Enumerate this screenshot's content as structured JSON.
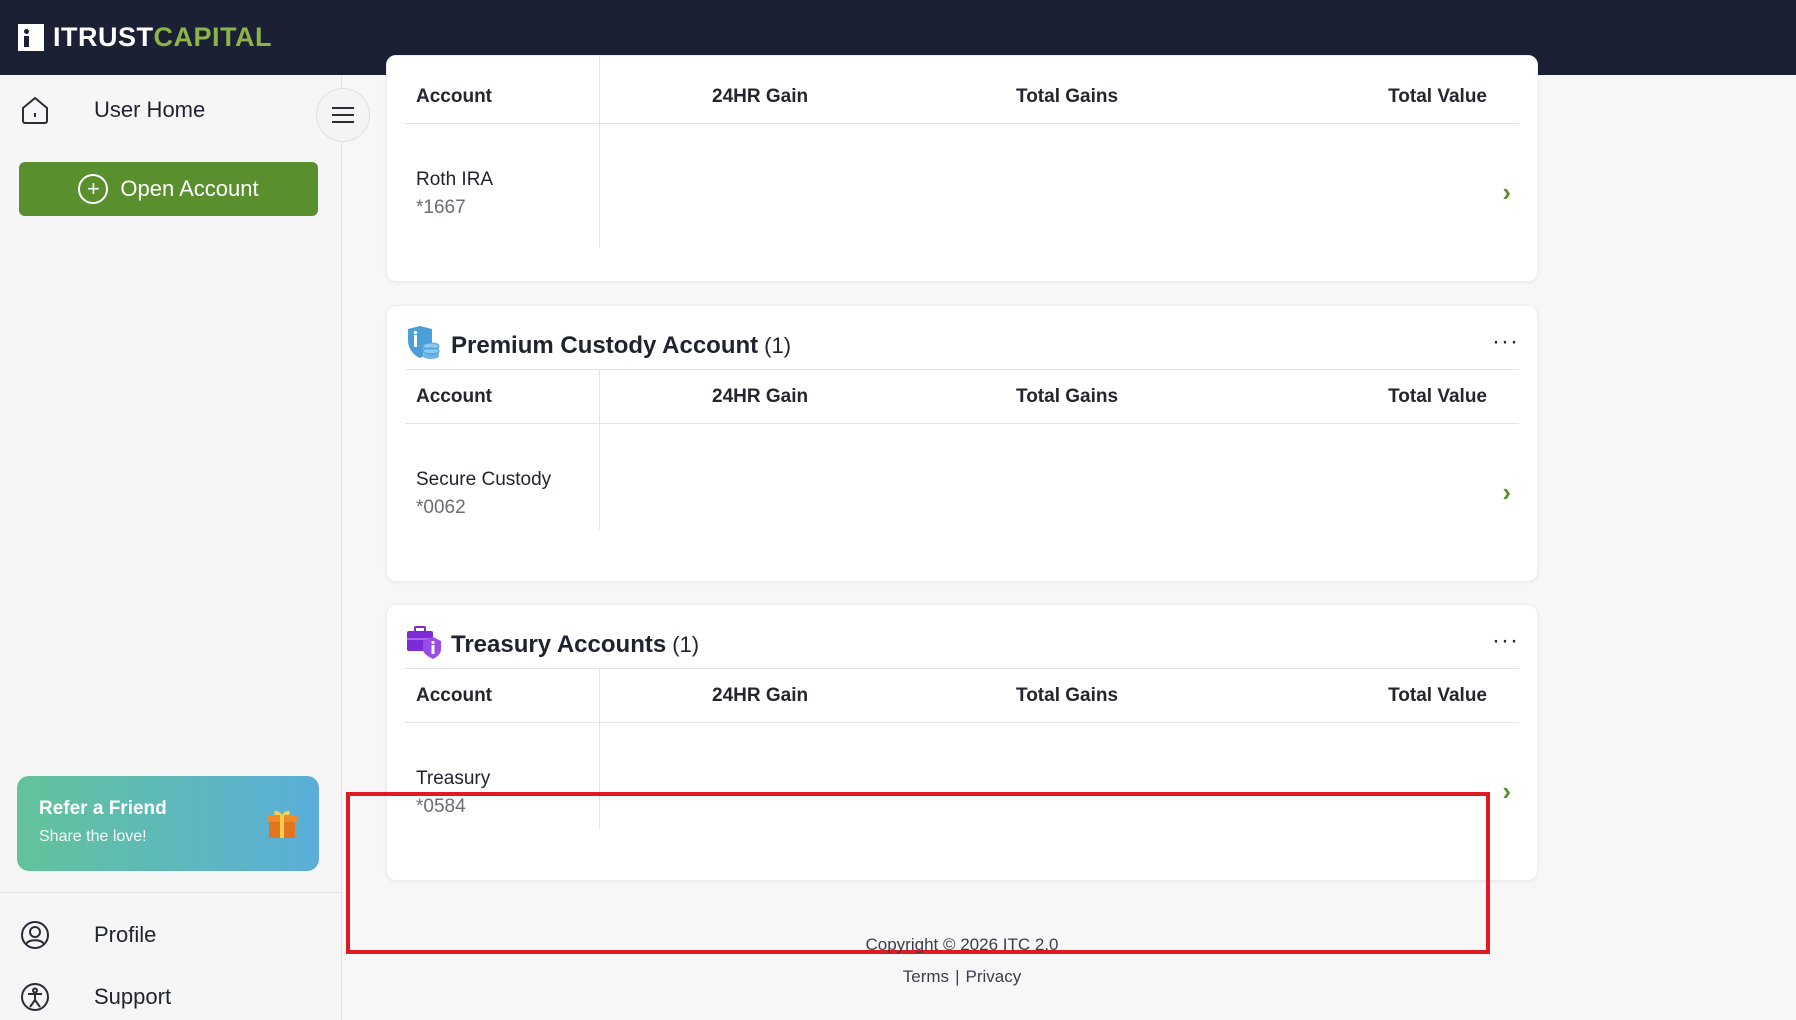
{
  "brand": {
    "name_part1": "ITRUST",
    "name_part2": "CAPITAL",
    "accent_color": "#8cb24a",
    "topbar_color": "#1b2035"
  },
  "sidebar": {
    "home_label": "User Home",
    "open_account_label": "Open Account",
    "refer": {
      "title": "Refer a Friend",
      "subtitle": "Share the love!"
    },
    "profile_label": "Profile",
    "support_label": "Support"
  },
  "columns": {
    "account": "Account",
    "gain24": "24HR Gain",
    "total_gains": "Total Gains",
    "total_value": "Total Value"
  },
  "sections": [
    {
      "title": "",
      "count": "",
      "accounts": [
        {
          "name": "Roth IRA",
          "number": "*1667"
        }
      ]
    },
    {
      "title": "Premium Custody Account",
      "count": "(1)",
      "icon": "custody-shield-coins-icon",
      "accounts": [
        {
          "name": "Secure Custody",
          "number": "*0062"
        }
      ]
    },
    {
      "title": "Treasury Accounts",
      "count": "(1)",
      "icon": "treasury-briefcase-icon",
      "accounts": [
        {
          "name": "Treasury",
          "number": "*0584"
        }
      ]
    }
  ],
  "footer": {
    "copyright": "Copyright © 2026 ITC 2.0",
    "terms": "Terms",
    "separator": "|",
    "privacy": "Privacy"
  },
  "colors": {
    "primary_green": "#5a8f2e",
    "highlight_red": "#e01a22"
  }
}
